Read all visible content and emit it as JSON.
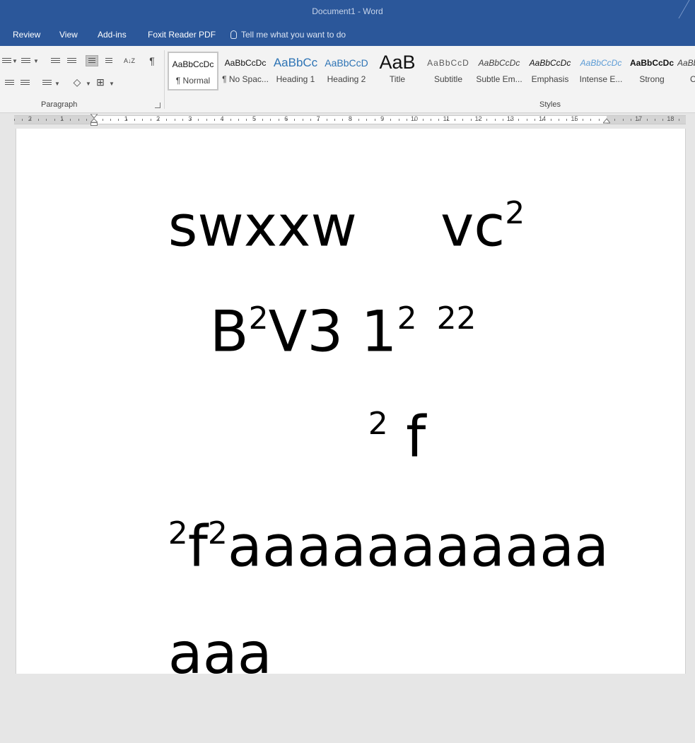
{
  "window": {
    "title": "Document1 - Word"
  },
  "menu": {
    "items": [
      "Review",
      "View",
      "Add-ins",
      "Foxit Reader PDF"
    ],
    "tell_me": "Tell me what you want to do"
  },
  "ribbon": {
    "paragraph_label": "Paragraph",
    "pilcrow": "¶",
    "sort_glyph": "A↓Z",
    "styles_label": "Styles",
    "styles": [
      {
        "preview": "AaBbCcDc",
        "name": "¶ Normal",
        "selected": true
      },
      {
        "preview": "AaBbCcDc",
        "name": "¶ No Spac..."
      },
      {
        "preview": "AaBbCc",
        "name": "Heading 1",
        "color": "#2e74b5"
      },
      {
        "preview": "AaBbCcD",
        "name": "Heading 2",
        "color": "#2e74b5"
      },
      {
        "preview": "AaB",
        "name": "Title"
      },
      {
        "preview": "AaBbCcD",
        "name": "Subtitle",
        "color": "#5a5a5a"
      },
      {
        "preview": "AaBbCcDc",
        "name": "Subtle Em...",
        "color": "#404040"
      },
      {
        "preview": "AaBbCcDc",
        "name": "Emphasis"
      },
      {
        "preview": "AaBbCcDc",
        "name": "Intense E...",
        "color": "#5b9bd5"
      },
      {
        "preview": "AaBbCcDc",
        "name": "Strong"
      },
      {
        "preview": "AaBb",
        "name": "C"
      }
    ]
  },
  "ruler": {
    "left_numbers": [
      "2",
      "1"
    ],
    "right_numbers": [
      "1",
      "2",
      "3",
      "4",
      "5",
      "6",
      "7",
      "8",
      "9",
      "10",
      "11",
      "12",
      "13",
      "14",
      "15",
      "17",
      "18"
    ]
  },
  "document": {
    "line1": {
      "a": "swxxw",
      "b": "vc",
      "b_sup": "2"
    },
    "line2": {
      "a": "B",
      "a_sup": "2",
      "b": "V3 1",
      "b_sup": "2",
      "c_sup": "22"
    },
    "line3": {
      "a_sup": "2",
      "b": " f"
    },
    "line4": {
      "a_sup": "2",
      "b": "f",
      "b_sup": "2",
      "c": "aaaaaaaaaaa"
    },
    "line5": {
      "a": "aaa"
    }
  }
}
